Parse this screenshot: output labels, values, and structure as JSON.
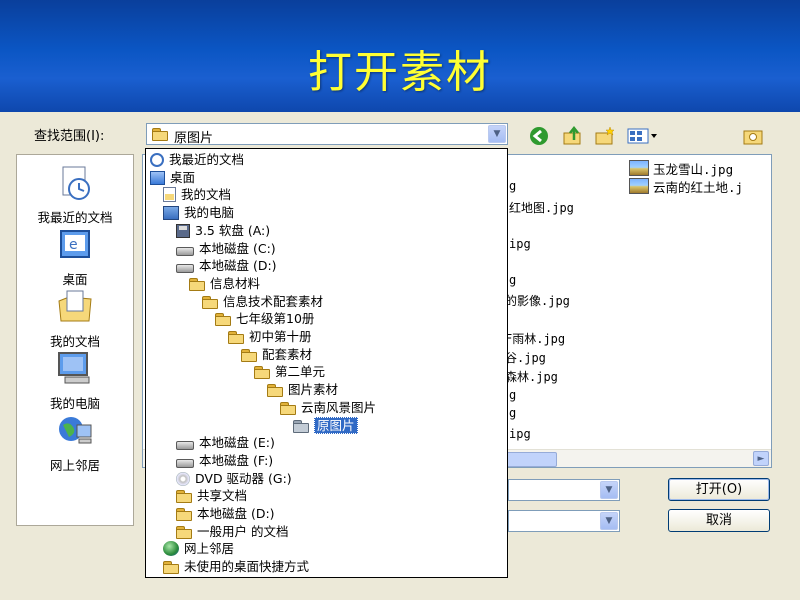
{
  "slide": {
    "title": "打开素材"
  },
  "dialog": {
    "look_in_label": "查找范围(I):",
    "look_in_value": "原图片",
    "places": [
      {
        "label": "我最近的文档",
        "icon": "recent-documents-icon"
      },
      {
        "label": "桌面",
        "icon": "desktop-icon"
      },
      {
        "label": "我的文档",
        "icon": "my-documents-icon"
      },
      {
        "label": "我的电脑",
        "icon": "my-computer-icon"
      },
      {
        "label": "网上邻居",
        "icon": "network-places-icon"
      }
    ],
    "files": [
      {
        "name": "玉龙雪山.jpg"
      },
      {
        "name": "云南的红土地.j"
      }
    ],
    "partial_files": [
      "g",
      "红地图.jpg",
      "ipg",
      "g",
      "的影像.jpg",
      "F雨林.jpg",
      "谷.jpg",
      "森林.jpg",
      "g",
      "ipg",
      "g"
    ],
    "buttons": {
      "open": "打开(O)",
      "cancel": "取消"
    },
    "dropdown_items": [
      {
        "label": "我最近的文档",
        "icon": "recent-documents-icon",
        "level": 0
      },
      {
        "label": "桌面",
        "icon": "desktop-icon",
        "level": 0
      },
      {
        "label": "我的文档",
        "icon": "my-documents-icon",
        "level": 1
      },
      {
        "label": "我的电脑",
        "icon": "my-computer-icon",
        "level": 1
      },
      {
        "label": "3.5 软盘 (A:)",
        "icon": "floppy-drive-icon",
        "level": 2
      },
      {
        "label": "本地磁盘 (C:)",
        "icon": "hard-drive-icon",
        "level": 2
      },
      {
        "label": "本地磁盘 (D:)",
        "icon": "hard-drive-icon",
        "level": 2
      },
      {
        "label": "信息材料",
        "icon": "folder-icon",
        "level": 3
      },
      {
        "label": "信息技术配套素材",
        "icon": "folder-icon",
        "level": 4
      },
      {
        "label": "七年级第10册",
        "icon": "folder-icon",
        "level": 5
      },
      {
        "label": "初中第十册",
        "icon": "folder-icon",
        "level": 6
      },
      {
        "label": "配套素材",
        "icon": "folder-icon",
        "level": 7
      },
      {
        "label": "第二单元",
        "icon": "folder-icon",
        "level": 8
      },
      {
        "label": "图片素材",
        "icon": "folder-icon",
        "level": 9
      },
      {
        "label": "云南风景图片",
        "icon": "folder-icon",
        "level": 10
      },
      {
        "label": "原图片",
        "icon": "open-folder-icon",
        "level": 11,
        "selected": true
      },
      {
        "label": "本地磁盘 (E:)",
        "icon": "hard-drive-icon",
        "level": 2
      },
      {
        "label": "本地磁盘 (F:)",
        "icon": "hard-drive-icon",
        "level": 2
      },
      {
        "label": "DVD 驱动器 (G:)",
        "icon": "dvd-drive-icon",
        "level": 2
      },
      {
        "label": "共享文档",
        "icon": "folder-icon",
        "level": 2
      },
      {
        "label": "本地磁盘 (D:)",
        "icon": "folder-icon",
        "level": 2
      },
      {
        "label": "一般用户 的文档",
        "icon": "folder-icon",
        "level": 2
      },
      {
        "label": "网上邻居",
        "icon": "network-places-icon",
        "level": 1
      },
      {
        "label": "未使用的桌面快捷方式",
        "icon": "folder-icon",
        "level": 1
      }
    ]
  }
}
